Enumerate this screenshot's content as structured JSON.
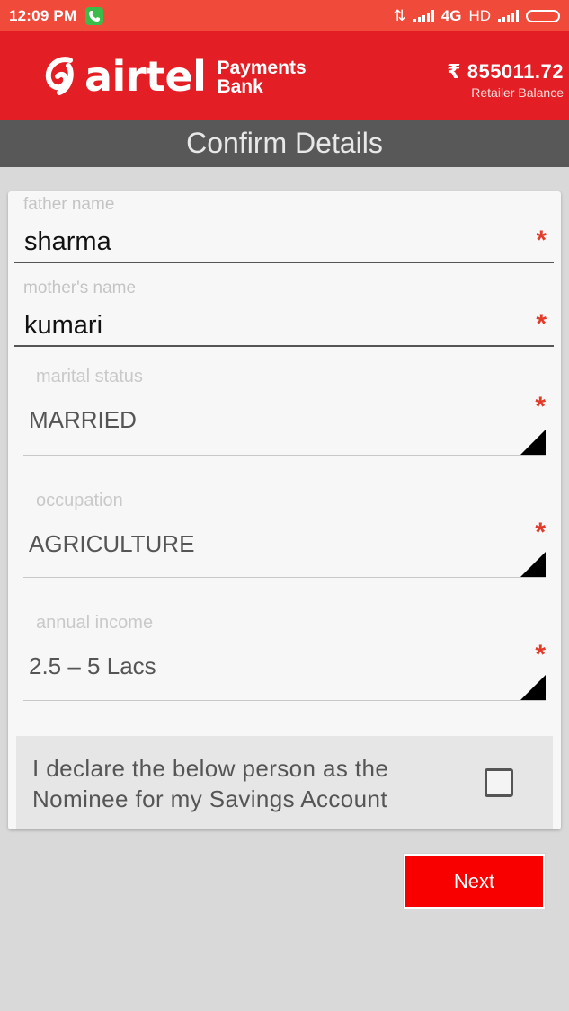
{
  "status_bar": {
    "time": "12:09 PM",
    "network": "4G",
    "hd": "HD"
  },
  "header": {
    "brand": "airtel",
    "brand_sub_1": "Payments",
    "brand_sub_2": "Bank",
    "balance": "₹ 855011.72",
    "balance_label": "Retailer Balance"
  },
  "page_title": "Confirm Details",
  "form": {
    "father_name": {
      "label": "father name",
      "value": "sharma",
      "required": "*"
    },
    "mother_name": {
      "label": "mother's name",
      "value": "kumari",
      "required": "*"
    },
    "marital_status": {
      "label": "marital status",
      "value": "MARRIED",
      "required": "*"
    },
    "occupation": {
      "label": "occupation",
      "value": "AGRICULTURE",
      "required": "*"
    },
    "annual_income": {
      "label": "annual income",
      "value": "2.5 – 5 Lacs",
      "required": "*"
    },
    "nominee_declaration": {
      "line1": "I declare the below person as the",
      "line2": "Nominee for my Savings Account",
      "checked": false
    }
  },
  "next_button": "Next",
  "colors": {
    "status_bar": "#f04a3a",
    "header": "#e31e24",
    "title_bar": "#585858",
    "required": "#e23b2a",
    "next_button": "#f80000"
  }
}
